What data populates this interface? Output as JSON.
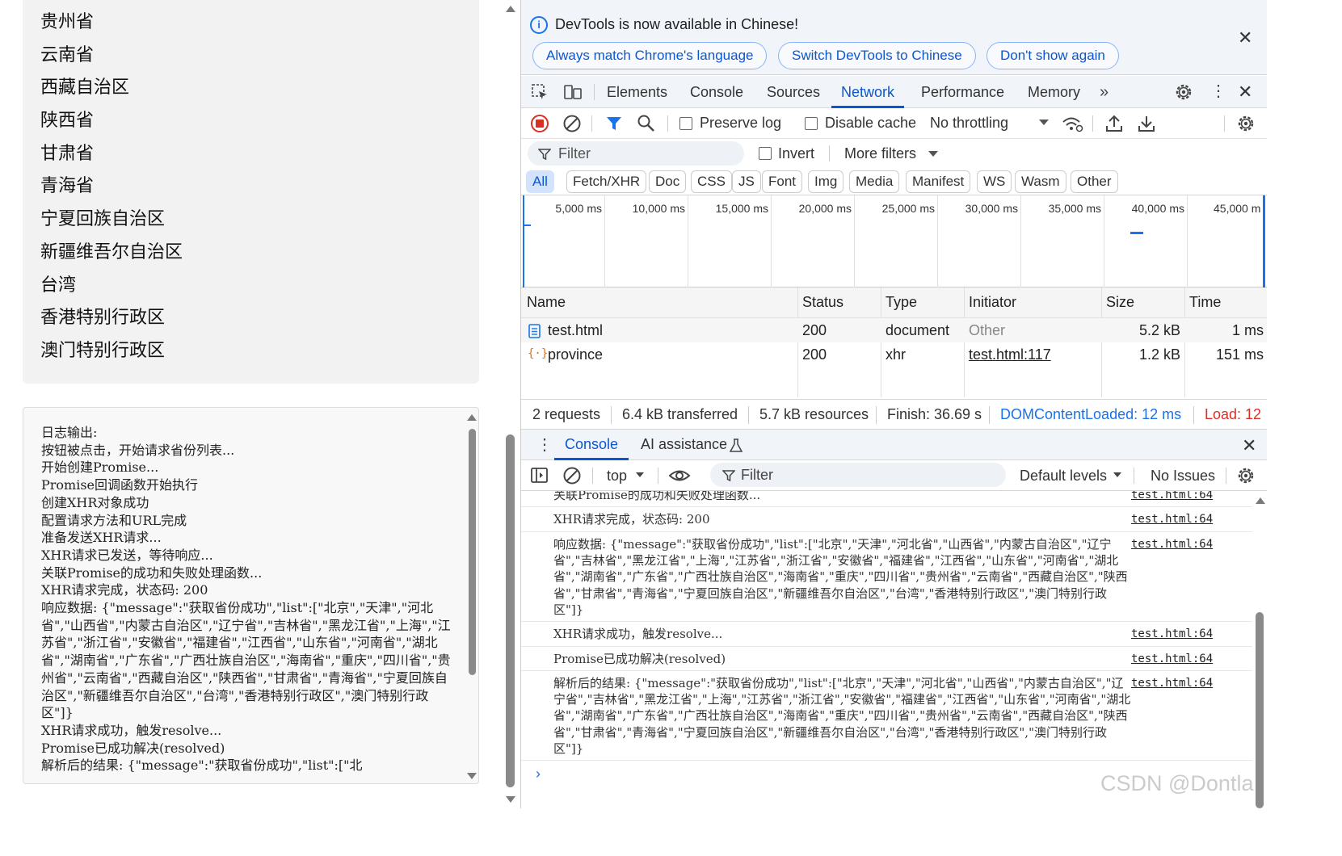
{
  "provinces": [
    "贵州省",
    "云南省",
    "西藏自治区",
    "陕西省",
    "甘肃省",
    "青海省",
    "宁夏回族自治区",
    "新疆维吾尔自治区",
    "台湾",
    "香港特别行政区",
    "澳门特别行政区"
  ],
  "log": {
    "text": "日志输出:\n按钮被点击，开始请求省份列表...\n开始创建Promise...\nPromise回调函数开始执行\n创建XHR对象成功\n配置请求方法和URL完成\n准备发送XHR请求...\nXHR请求已发送，等待响应...\n关联Promise的成功和失败处理函数...\nXHR请求完成，状态码: 200\n响应数据: {\"message\":\"获取省份成功\",\"list\":[\"北京\",\"天津\",\"河北省\",\"山西省\",\"内蒙古自治区\",\"辽宁省\",\"吉林省\",\"黑龙江省\",\"上海\",\"江苏省\",\"浙江省\",\"安徽省\",\"福建省\",\"江西省\",\"山东省\",\"河南省\",\"湖北省\",\"湖南省\",\"广东省\",\"广西壮族自治区\",\"海南省\",\"重庆\",\"四川省\",\"贵州省\",\"云南省\",\"西藏自治区\",\"陕西省\",\"甘肃省\",\"青海省\",\"宁夏回族自治区\",\"新疆维吾尔自治区\",\"台湾\",\"香港特别行政区\",\"澳门特别行政区\"]}\nXHR请求成功，触发resolve...\nPromise已成功解决(resolved)\n解析后的结果: {\"message\":\"获取省份成功\",\"list\":[\"北"
  },
  "devtools": {
    "infobar": {
      "message": "DevTools is now available in Chinese!",
      "btn_match": "Always match Chrome's language",
      "btn_switch": "Switch DevTools to Chinese",
      "btn_dont": "Don't show again"
    },
    "tabs": [
      "Elements",
      "Console",
      "Sources",
      "Network",
      "Performance",
      "Memory"
    ],
    "network_toolbar": {
      "preserve_log": "Preserve log",
      "disable_cache": "Disable cache",
      "throttling": "No throttling"
    },
    "filter_bar": {
      "placeholder": "Filter",
      "invert": "Invert",
      "more_filters": "More filters"
    },
    "type_filters": [
      "All",
      "Fetch/XHR",
      "Doc",
      "CSS",
      "JS",
      "Font",
      "Img",
      "Media",
      "Manifest",
      "WS",
      "Wasm",
      "Other"
    ],
    "timeline_ticks": [
      "5,000 ms",
      "10,000 ms",
      "15,000 ms",
      "20,000 ms",
      "25,000 ms",
      "30,000 ms",
      "35,000 ms",
      "40,000 ms",
      "45,000 m"
    ],
    "columns": [
      "Name",
      "Status",
      "Type",
      "Initiator",
      "Size",
      "Time"
    ],
    "requests": [
      {
        "name": "test.html",
        "status": "200",
        "type": "document",
        "initiator": "Other",
        "size": "5.2 kB",
        "time": "1 ms"
      },
      {
        "name": "province",
        "status": "200",
        "type": "xhr",
        "initiator": "test.html:117",
        "size": "1.2 kB",
        "time": "151 ms"
      }
    ],
    "summary": {
      "requests": "2 requests",
      "transferred": "6.4 kB transferred",
      "resources": "5.7 kB resources",
      "finish": "Finish: 36.69 s",
      "dcl": "DOMContentLoaded: 12 ms",
      "load": "Load: 12"
    },
    "drawer": {
      "console": "Console",
      "ai": "AI assistance"
    },
    "console_toolbar": {
      "context": "top",
      "filter": "Filter",
      "levels": "Default levels",
      "issues": "No Issues"
    },
    "console_messages": [
      {
        "text": "关联Promise的成功和失败处理函数...",
        "source": "test.html:64"
      },
      {
        "text": "XHR请求完成，状态码: 200",
        "source": "test.html:64"
      },
      {
        "text": "响应数据: {\"message\":\"获取省份成功\",\"list\":[\"北京\",\"天津\",\"河北省\",\"山西省\",\"内蒙古自治区\",\"辽宁省\",\"吉林省\",\"黑龙江省\",\"上海\",\"江苏省\",\"浙江省\",\"安徽省\",\"福建省\",\"江西省\",\"山东省\",\"河南省\",\"湖北省\",\"湖南省\",\"广东省\",\"广西壮族自治区\",\"海南省\",\"重庆\",\"四川省\",\"贵州省\",\"云南省\",\"西藏自治区\",\"陕西省\",\"甘肃省\",\"青海省\",\"宁夏回族自治区\",\"新疆维吾尔自治区\",\"台湾\",\"香港特别行政区\",\"澳门特别行政区\"]}",
        "source": "test.html:64"
      },
      {
        "text": "XHR请求成功，触发resolve...",
        "source": "test.html:64"
      },
      {
        "text": "Promise已成功解决(resolved)",
        "source": "test.html:64"
      },
      {
        "text": "解析后的结果: {\"message\":\"获取省份成功\",\"list\":[\"北京\",\"天津\",\"河北省\",\"山西省\",\"内蒙古自治区\",\"辽宁省\",\"吉林省\",\"黑龙江省\",\"上海\",\"江苏省\",\"浙江省\",\"安徽省\",\"福建省\",\"江西省\",\"山东省\",\"河南省\",\"湖北省\",\"湖南省\",\"广东省\",\"广西壮族自治区\",\"海南省\",\"重庆\",\"四川省\",\"贵州省\",\"云南省\",\"西藏自治区\",\"陕西省\",\"甘肃省\",\"青海省\",\"宁夏回族自治区\",\"新疆维吾尔自治区\",\"台湾\",\"香港特别行政区\",\"澳门特别行政区\"]}",
        "source": "test.html:64"
      }
    ]
  },
  "watermark": "CSDN @Dontla",
  "colors": {
    "accent": "#0b57d0",
    "record_red": "#d93025",
    "load_red": "#d93025",
    "dcl_blue": "#1a73e8"
  }
}
